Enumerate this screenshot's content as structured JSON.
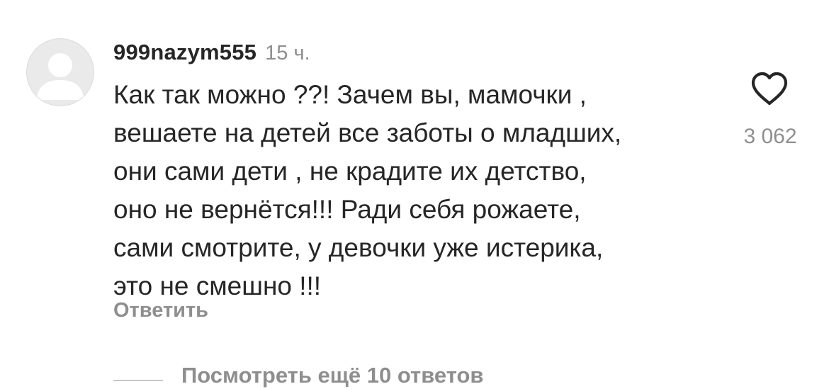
{
  "comment": {
    "avatar_icon": "default-avatar-icon",
    "username": "999nazym555",
    "time": "15 ч.",
    "text": "Как так можно ??! Зачем вы, мамочки ,\nвешаете на детей все заботы о младших,\nони сами дети , не крадите их детство,\nоно не вернётся!!! Ради себя рожаете,\nсами смотрите,  у девочки уже истерика,\nэто не смешно !!!",
    "like_icon": "heart-outline-icon",
    "like_count": "3 062",
    "reply_label": "Ответить",
    "view_replies_label": "Посмотреть ещё 10 ответов"
  },
  "colors": {
    "primary_text": "#262626",
    "secondary_text": "#8e8e8e",
    "avatar_bg": "#eaeaea",
    "avatar_figure": "#ffffff",
    "divider": "#c7c7c7"
  }
}
